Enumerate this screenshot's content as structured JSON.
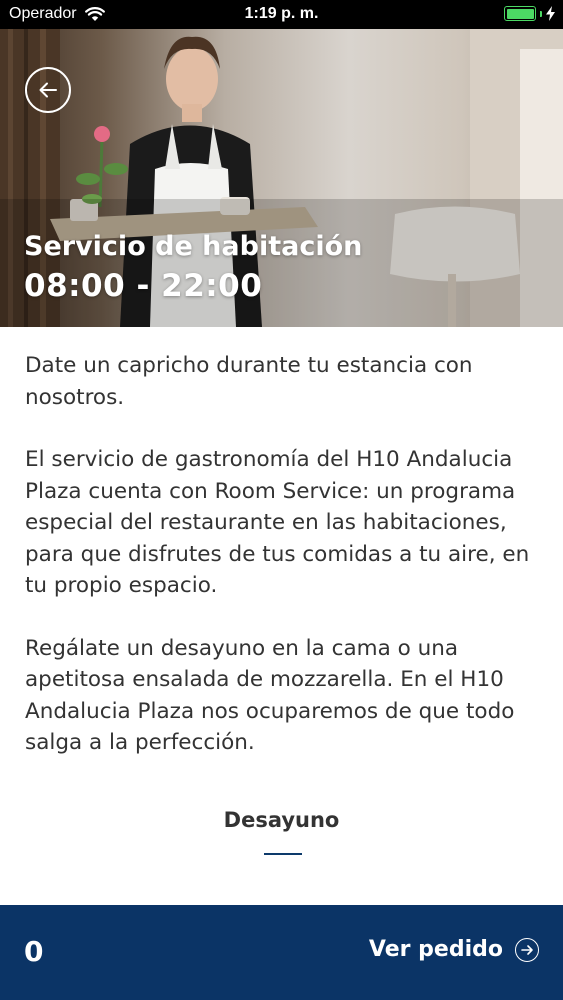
{
  "status_bar": {
    "carrier": "Operador",
    "time": "1:19 p. m.",
    "battery_level": 1.0,
    "colors": {
      "battery": "#4cd964"
    }
  },
  "hero": {
    "back_icon": "arrow-left-circle-icon",
    "title": "Servicio de habitación",
    "hours": "08:00 - 22:00"
  },
  "description": [
    "Date un capricho durante tu estancia con nosotros.",
    "El servicio de gastronomía del H10 Andalucia Plaza cuenta con Room Service: un programa especial del restaurante en las habitaciones, para que disfrutes de tus comidas a tu aire, en tu propio espacio.",
    "Regálate un desayuno en la cama o una apetitosa ensalada de mozzarella. En el H10 Andalucia Plaza nos ocuparemos de que todo salga a la perfección."
  ],
  "tabs": [
    {
      "label": "Desayuno",
      "active": true
    }
  ],
  "order_bar": {
    "count": "0",
    "view_order_label": "Ver pedido",
    "icon": "arrow-right-circle-icon",
    "colors": {
      "background": "#0b3466",
      "accent": "#0d3a6b"
    }
  }
}
